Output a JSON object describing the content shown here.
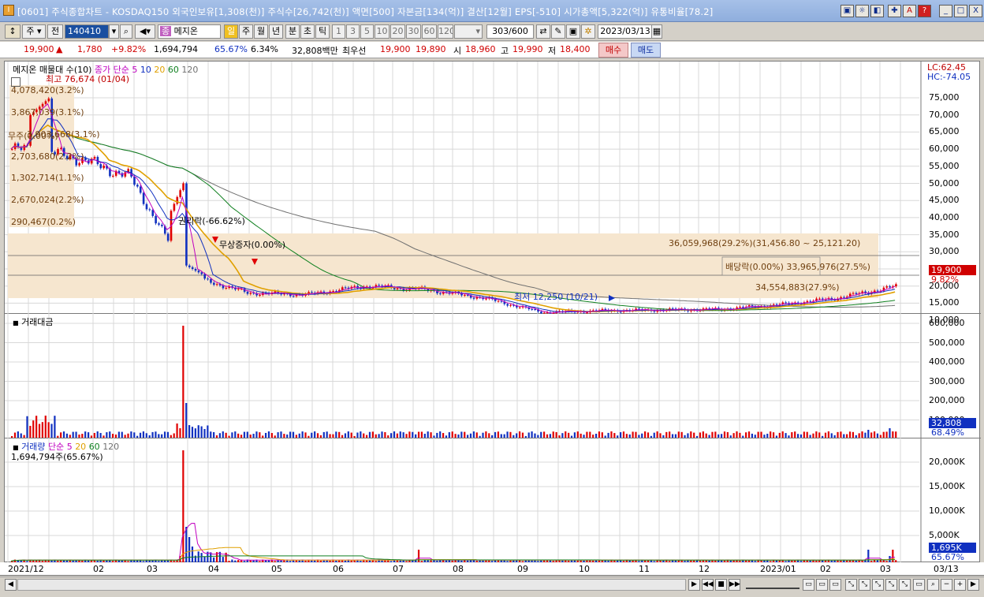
{
  "window": {
    "title": "[0601] 주식종합차트 - KOSDAQ150 외국인보유[1,308(천)] 주식수[26,742(천)] 액면[500] 자본금[134(억)] 결산[12월] EPS[-510] 시가총액[5,322(억)] 유통비율[78.2]",
    "buttons": [
      "▣",
      "☼",
      "◧",
      "✚",
      "A",
      "?",
      "_",
      "□",
      "X"
    ]
  },
  "toolbar": {
    "type_select": "주",
    "mode": "전",
    "code": "140410",
    "name": "메지온",
    "periods": [
      "일",
      "주",
      "월",
      "년",
      "분",
      "초",
      "틱"
    ],
    "ticks": [
      "1",
      "3",
      "5",
      "10",
      "20",
      "30",
      "60",
      "120"
    ],
    "count": "303",
    "count_max": "/600",
    "date": "2023/03/13"
  },
  "quote": {
    "price": "19,900",
    "arrow": "▲",
    "change": "1,780",
    "change_pct": "+9.82%",
    "volume": "1,694,794",
    "vol_ratio": "65.67%",
    "turnover": "6.34%",
    "amount": "32,808백만",
    "best_label": "최우선",
    "ask": "19,900",
    "bid": "19,890",
    "open_label": "시",
    "open": "18,960",
    "high_label": "고",
    "high": "19,990",
    "low_label": "저",
    "low": "18,400",
    "buy": "매수",
    "sell": "매도"
  },
  "price_panel": {
    "label_name": "메지온 매물대 수(10)",
    "ma_label": "종가 단순",
    "ma_periods": [
      "5",
      "10",
      "20",
      "60",
      "120"
    ],
    "ma_colors": [
      "#c000c0",
      "#1030c0",
      "#e0a000",
      "#108020",
      "#707070"
    ],
    "lc": "LC:62.45",
    "hc": "HC:-74.05",
    "high_note": "최고 76,674 (01/04)",
    "low_note": "최저 12,250 (10/21)",
    "event1": "권리락(-66.62%)",
    "event2": "무상증자(0.00%)",
    "vp_right": "36,059,968(29.2%)(31,456.80 ~ 25,121.20)",
    "vp_right2": "배당락(0.00%)",
    "vp_right3": "33,965,976(27.5%)",
    "vp_right4": "34,554,883(27.9%)",
    "vp_left": [
      "4,078,420(3.2%)",
      "3,867,039(3.1%)",
      "3,903,668(3.1%)",
      "2,703,680(2.2%)",
      "1,302,714(1.1%)",
      "2,670,024(2.2%)",
      "290,467(0.2%)"
    ],
    "vp_left2": "무주(0.00%)",
    "last_price": "19,900",
    "last_pct": "9.82%",
    "yticks": [
      "75,000",
      "70,000",
      "65,000",
      "60,000",
      "55,000",
      "50,000",
      "45,000",
      "40,000",
      "35,000",
      "30,000",
      "25,000",
      "20,000",
      "15,000",
      "10,000"
    ]
  },
  "amount_panel": {
    "label": "거래대금",
    "yticks": [
      "600,000",
      "500,000",
      "400,000",
      "300,000",
      "200,000",
      "100,000"
    ],
    "last": "32,808",
    "last_pct": "68.49%"
  },
  "volume_panel": {
    "label": "거래량",
    "ma_label": "단순",
    "ma_periods": [
      "5",
      "20",
      "60",
      "120"
    ],
    "info": "1,694,794주(65.67%)",
    "yticks": [
      "20,000K",
      "15,000K",
      "10,000K",
      "5,000K"
    ],
    "last": "1,695K",
    "last_pct": "65.67%"
  },
  "xaxis": {
    "labels": [
      "2021/12",
      "02",
      "03",
      "04",
      "05",
      "06",
      "07",
      "08",
      "09",
      "10",
      "11",
      "12",
      "2023/01",
      "02",
      "03"
    ],
    "right": "03/13"
  },
  "chart_data": {
    "type": "candlestick",
    "x": [
      "2021/12",
      "02",
      "03",
      "04",
      "05",
      "06",
      "07",
      "08",
      "09",
      "10",
      "11",
      "12",
      "2023/01",
      "02",
      "03",
      "03/13"
    ],
    "close": [
      60000,
      58000,
      52000,
      23000,
      18000,
      17500,
      20000,
      19000,
      16500,
      12300,
      12800,
      13000,
      13200,
      14500,
      16500,
      19900
    ],
    "high_mark": 76674,
    "low_mark": 12250,
    "ylim": [
      8000,
      78000
    ]
  }
}
